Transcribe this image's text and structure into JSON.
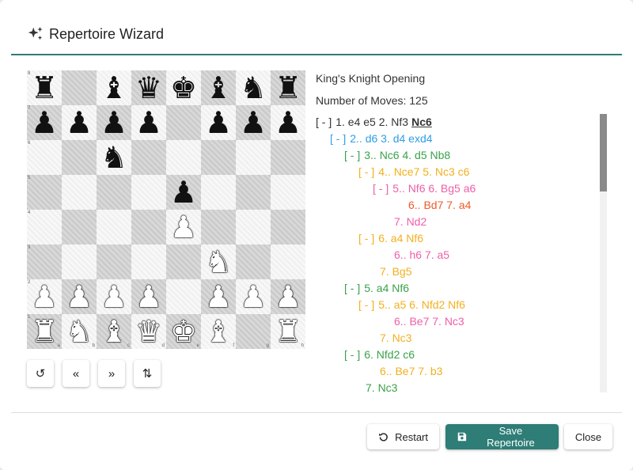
{
  "colors": {
    "accent": "#2e7d76",
    "depth": [
      "#333333",
      "#2e9ee6",
      "#3aa24a",
      "#f2b01e",
      "#ee5fa7",
      "#f05a28"
    ]
  },
  "header": {
    "title": "Repertoire Wizard",
    "icon": "sparkle-icon"
  },
  "opening": {
    "name": "King's Knight Opening",
    "move_count_label": "Number of Moves: 125"
  },
  "board": {
    "rows": [
      [
        "r",
        "",
        "b",
        "q",
        "k",
        "b",
        "n",
        "r"
      ],
      [
        "p",
        "p",
        "p",
        "p",
        "",
        "p",
        "p",
        "p"
      ],
      [
        "",
        "",
        "n",
        "",
        "",
        "",
        "",
        ""
      ],
      [
        "",
        "",
        "",
        "",
        "p",
        "",
        "",
        ""
      ],
      [
        "",
        "",
        "",
        "",
        "P",
        "",
        "",
        ""
      ],
      [
        "",
        "",
        "",
        "",
        "",
        "N",
        "",
        ""
      ],
      [
        "P",
        "P",
        "P",
        "P",
        "",
        "P",
        "P",
        "P"
      ],
      [
        "R",
        "N",
        "B",
        "Q",
        "K",
        "B",
        "",
        "R"
      ]
    ],
    "rank_labels": [
      "8",
      "7",
      "6",
      "5",
      "4",
      "3",
      "2",
      "1"
    ],
    "file_labels": [
      "a",
      "b",
      "c",
      "d",
      "e",
      "f",
      "g",
      "h"
    ]
  },
  "controls": [
    {
      "name": "reset-board-button",
      "icon": "rotate-ccw-icon",
      "glyph": "↺"
    },
    {
      "name": "previous-move-button",
      "icon": "double-chevron-left-icon",
      "glyph": "«"
    },
    {
      "name": "next-move-button",
      "icon": "double-chevron-right-icon",
      "glyph": "»"
    },
    {
      "name": "flip-board-button",
      "icon": "swap-vertical-icon",
      "glyph": "⇅"
    }
  ],
  "tree": [
    {
      "indent": 0,
      "depth": 0,
      "toggle": "[-]",
      "text": "1. e4 e5 2. Nf3",
      "current": "Nc6"
    },
    {
      "indent": 1,
      "depth": 1,
      "toggle": "[-]",
      "text": "2.. d6 3. d4 exd4"
    },
    {
      "indent": 2,
      "depth": 2,
      "toggle": "[-]",
      "text": "3.. Nc6 4. d5 Nb8"
    },
    {
      "indent": 3,
      "depth": 3,
      "toggle": "[-]",
      "text": "4.. Nce7 5. Nc3 c6"
    },
    {
      "indent": 4,
      "depth": 4,
      "toggle": "[-]",
      "text": "5.. Nf6 6. Bg5 a6"
    },
    {
      "indent": 6.5,
      "depth": 5,
      "toggle": "",
      "text": "6.. Bd7 7. a4"
    },
    {
      "indent": 5.5,
      "depth": 4,
      "toggle": "",
      "text": "7. Nd2"
    },
    {
      "indent": 3,
      "depth": 3,
      "toggle": "[-]",
      "text": "6. a4 Nf6"
    },
    {
      "indent": 5.5,
      "depth": 4,
      "toggle": "",
      "text": "6.. h6 7. a5"
    },
    {
      "indent": 4.5,
      "depth": 3,
      "toggle": "",
      "text": "7. Bg5"
    },
    {
      "indent": 2,
      "depth": 2,
      "toggle": "[-]",
      "text": "5. a4 Nf6"
    },
    {
      "indent": 3,
      "depth": 3,
      "toggle": "[-]",
      "text": "5.. a5 6. Nfd2 Nf6"
    },
    {
      "indent": 5.5,
      "depth": 4,
      "toggle": "",
      "text": "6.. Be7 7. Nc3"
    },
    {
      "indent": 4.5,
      "depth": 3,
      "toggle": "",
      "text": "7. Nc3"
    },
    {
      "indent": 2,
      "depth": 2,
      "toggle": "[-]",
      "text": "6. Nfd2 c6"
    },
    {
      "indent": 4.5,
      "depth": 3,
      "toggle": "",
      "text": "6.. Be7 7. b3"
    },
    {
      "indent": 3.5,
      "depth": 2,
      "toggle": "",
      "text": "7. Nc3"
    }
  ],
  "buttons": {
    "restart": "Restart",
    "save": "Save Repertoire",
    "close": "Close"
  }
}
